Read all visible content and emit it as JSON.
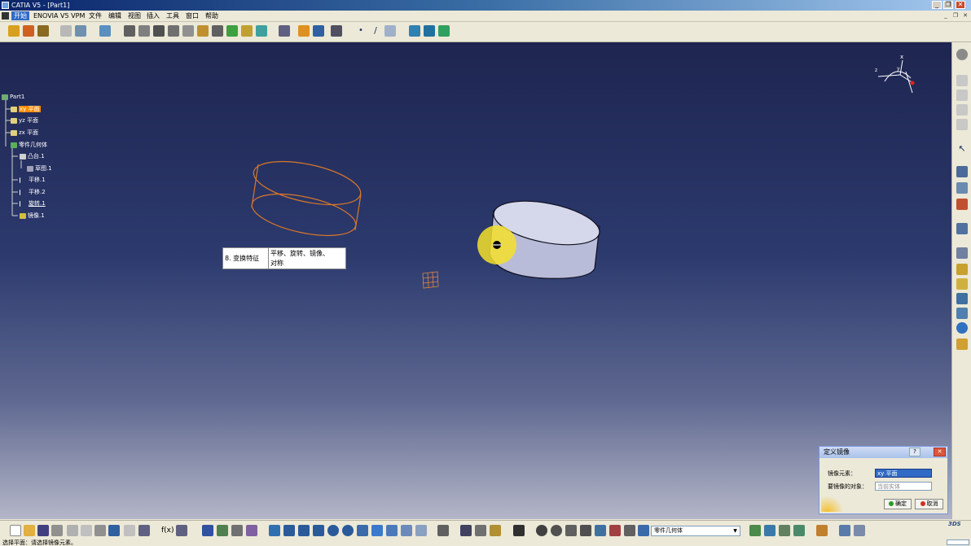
{
  "window": {
    "title": "CATIA V5 - [Part1]",
    "controls": {
      "minimize": "_",
      "restore": "❐",
      "close": "✕"
    }
  },
  "menubar": {
    "items": [
      "开始",
      "ENOVIA V5 VPM",
      "文件",
      "编辑",
      "视图",
      "插入",
      "工具",
      "窗口",
      "帮助"
    ]
  },
  "tree": {
    "root": "Part1",
    "nodes": [
      {
        "label": "xy 平面",
        "selected": true
      },
      {
        "label": "yz 平面"
      },
      {
        "label": "zx 平面"
      },
      {
        "label": "零件几何体"
      },
      {
        "label": "凸台.1"
      },
      {
        "label": "草图.1"
      },
      {
        "label": "平移.1"
      },
      {
        "label": "平移.2"
      },
      {
        "label": "旋转.1"
      },
      {
        "label": "镜像.1"
      }
    ]
  },
  "annotation": {
    "left": "8. 变换特征",
    "right_line1": "平移、旋转、镜像、",
    "right_line2": "对称"
  },
  "compass": {
    "x_label": "x",
    "y_label": "y",
    "z_label": "z"
  },
  "dialog": {
    "title": "定义镜像",
    "help": "?",
    "close": "✕",
    "mirror_element_label": "镜像元素：",
    "mirror_element_value": "xy 平面",
    "object_label": "要镜像的对象：",
    "object_value": "当前实体",
    "ok": "确定",
    "cancel": "取消"
  },
  "bottom_toolbar": {
    "body_combo": "零件几何体"
  },
  "status": "选择平面：请选择镜像元素。",
  "colors": {
    "selection": "#ff8c00",
    "wireframe": "#d9772a",
    "solid": "#c8cbe3",
    "highlight": "#f5e02a"
  }
}
